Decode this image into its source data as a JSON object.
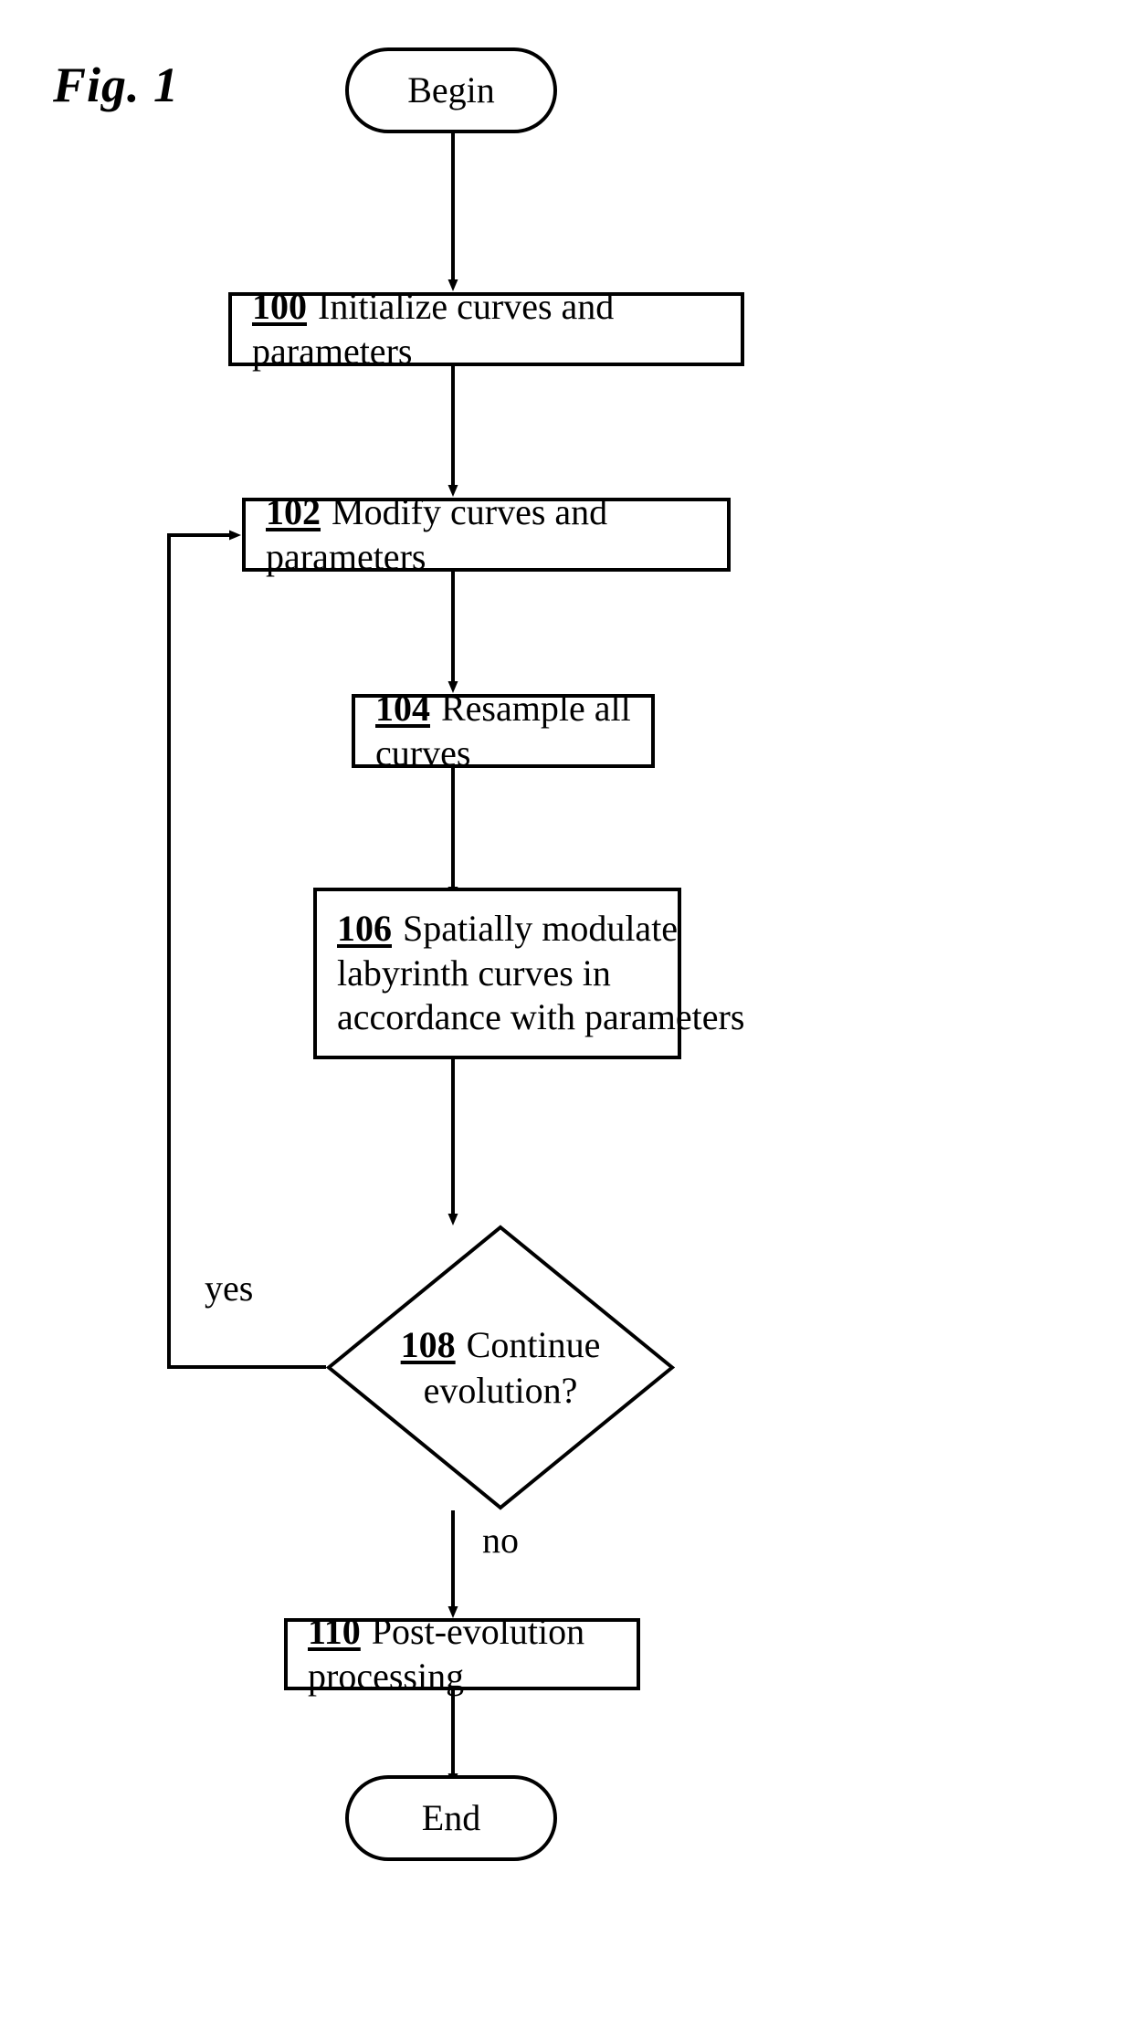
{
  "figure": {
    "caption": "Fig. 1",
    "background_color": "#ffffff",
    "stroke_color": "#000000"
  },
  "nodes": {
    "begin": {
      "label": "Begin",
      "shape": "terminal"
    },
    "n100": {
      "ref": "100",
      "text": "Initialize curves and parameters",
      "shape": "process"
    },
    "n102": {
      "ref": "102",
      "text": "Modify curves and parameters",
      "shape": "process"
    },
    "n104": {
      "ref": "104",
      "text": "Resample all curves",
      "shape": "process"
    },
    "n106": {
      "ref": "106",
      "line1": "Spatially modulate",
      "line2": "labyrinth curves in",
      "line3": "accordance with parameters",
      "shape": "process"
    },
    "n108": {
      "ref": "108",
      "line1": "Continue",
      "line2": "evolution?",
      "shape": "decision"
    },
    "n110": {
      "ref": "110",
      "text": "Post-evolution processing",
      "shape": "process"
    },
    "end": {
      "label": "End",
      "shape": "terminal"
    }
  },
  "edges": {
    "yes_label": "yes",
    "no_label": "no"
  },
  "chart_data": {
    "type": "flowchart",
    "title": "Fig. 1",
    "nodes": [
      {
        "id": "begin",
        "kind": "terminal",
        "label": "Begin"
      },
      {
        "id": "100",
        "kind": "process",
        "label": "100 Initialize curves and parameters"
      },
      {
        "id": "102",
        "kind": "process",
        "label": "102 Modify curves and parameters"
      },
      {
        "id": "104",
        "kind": "process",
        "label": "104 Resample all curves"
      },
      {
        "id": "106",
        "kind": "process",
        "label": "106 Spatially modulate labyrinth curves in accordance with parameters"
      },
      {
        "id": "108",
        "kind": "decision",
        "label": "108 Continue evolution?"
      },
      {
        "id": "110",
        "kind": "process",
        "label": "110 Post-evolution processing"
      },
      {
        "id": "end",
        "kind": "terminal",
        "label": "End"
      }
    ],
    "edges": [
      {
        "from": "begin",
        "to": "100",
        "label": ""
      },
      {
        "from": "100",
        "to": "102",
        "label": ""
      },
      {
        "from": "102",
        "to": "104",
        "label": ""
      },
      {
        "from": "104",
        "to": "106",
        "label": ""
      },
      {
        "from": "106",
        "to": "108",
        "label": ""
      },
      {
        "from": "108",
        "to": "102",
        "label": "yes"
      },
      {
        "from": "108",
        "to": "110",
        "label": "no"
      },
      {
        "from": "110",
        "to": "end",
        "label": ""
      }
    ]
  }
}
